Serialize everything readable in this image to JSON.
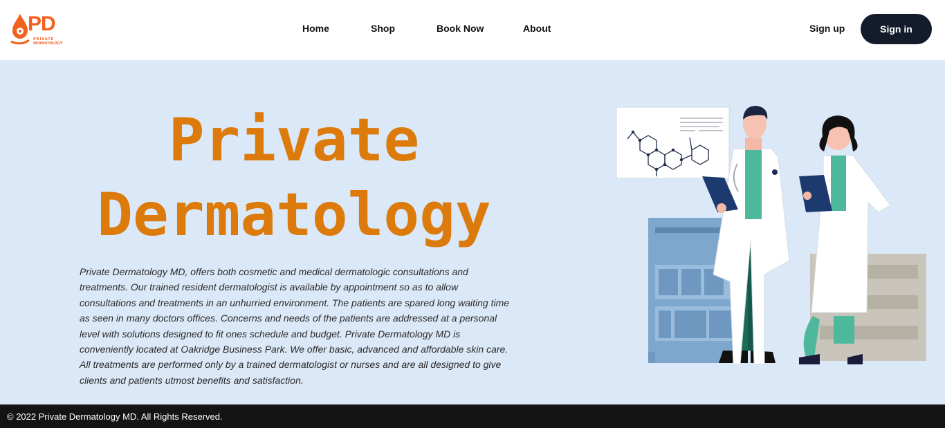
{
  "logo": {
    "mark": "PD",
    "line1": "PRIVATE",
    "line2": "DERMATOLOGY"
  },
  "nav": {
    "items": [
      "Home",
      "Shop",
      "Book Now",
      "About"
    ]
  },
  "auth": {
    "signup": "Sign up",
    "signin": "Sign in"
  },
  "hero": {
    "title_line1": "Private",
    "title_line2": "Dermatology",
    "description": "Private Dermatology MD, offers both cosmetic and medical dermatologic consultations and treatments. Our trained resident dermatologist is available by appointment so as to allow consultations and treatments in an unhurried environment. The patients are spared long waiting time as seen in many doctors offices. Concerns and needs of the patients are addressed at a personal level with solutions designed to fit ones schedule and budget. Private Dermatology MD is conveniently located at Oakridge Business Park. We offer basic, advanced and affordable skin care. All treatments are performed only by a trained dermatologist or nurses and are all designed to give clients and patients utmost benefits and satisfaction."
  },
  "footer": {
    "copyright": "© 2022 Private Dermatology MD. All Rights Reserved."
  },
  "colors": {
    "brand_orange": "#f2611d",
    "title_orange": "#dc7a0b",
    "hero_bg": "#dbe8f7",
    "button_dark": "#141c2c",
    "footer_bg": "#141414"
  }
}
